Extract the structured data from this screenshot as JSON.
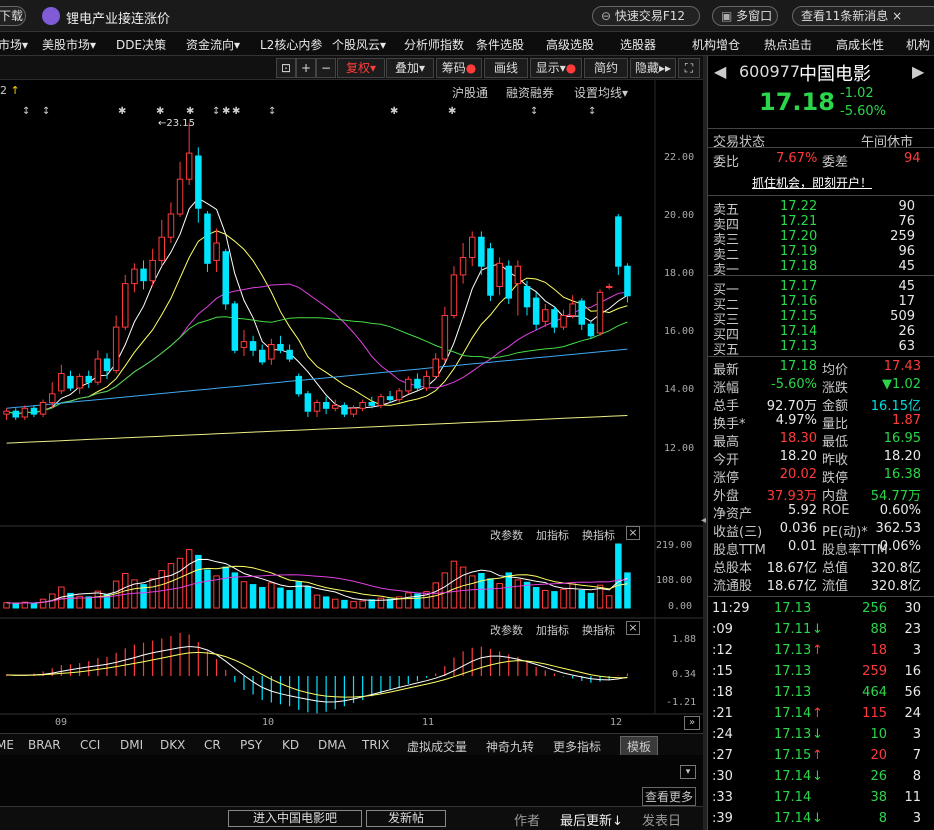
{
  "topbar": {
    "download": "下载",
    "news_ticker": "锂电产业接连涨价",
    "quick_trade": "快速交易F12",
    "multi_window": "多窗口",
    "view_news": "查看11条新消息",
    "close": "×"
  },
  "nav": [
    "市场",
    "美股市场",
    "DDE决策",
    "资金流向",
    "L2核心内参",
    "个股风云",
    "分析师指数",
    "条件选股",
    "高级选股",
    "选股器",
    "机构增仓",
    "热点追击",
    "高成长性",
    "机构"
  ],
  "chart_toolbar": {
    "fuquan": "复权",
    "overlay": "叠加",
    "chips": "筹码",
    "draw": "画线",
    "display": "显示",
    "simple": "简约",
    "hide": "隐藏"
  },
  "chart_header": {
    "period_num": "2",
    "hgt": "沪股通",
    "margin": "融资融券",
    "ma_settings": "设置均线",
    "peak_label": "23.15"
  },
  "chart_data": {
    "type": "candlestick",
    "price_axis": {
      "ticks": [
        "22.00",
        "20.00",
        "18.00",
        "16.00",
        "14.00",
        "12.00"
      ]
    },
    "volume_axis": {
      "ticks": [
        "219.00",
        "108.00",
        "0.00"
      ]
    },
    "macd_axis": {
      "ticks": [
        "1.88",
        "0.34",
        "-1.21"
      ]
    },
    "x_labels": [
      "09",
      "10",
      "11",
      "12"
    ],
    "peak": 23.15,
    "last_close": 17.18,
    "candles": [
      {
        "o": 13.1,
        "c": 13.2,
        "h": 13.3,
        "l": 12.9
      },
      {
        "o": 13.2,
        "c": 13.0,
        "h": 13.3,
        "l": 12.9
      },
      {
        "o": 13.0,
        "c": 13.3,
        "h": 13.4,
        "l": 12.9
      },
      {
        "o": 13.3,
        "c": 13.1,
        "h": 13.4,
        "l": 13.0
      },
      {
        "o": 13.1,
        "c": 13.5,
        "h": 13.6,
        "l": 13.0
      },
      {
        "o": 13.5,
        "c": 13.8,
        "h": 14.2,
        "l": 13.3
      },
      {
        "o": 13.9,
        "c": 14.5,
        "h": 14.8,
        "l": 13.8
      },
      {
        "o": 14.4,
        "c": 14.0,
        "h": 14.6,
        "l": 13.9
      },
      {
        "o": 14.0,
        "c": 14.4,
        "h": 14.5,
        "l": 13.8
      },
      {
        "o": 14.4,
        "c": 14.2,
        "h": 14.6,
        "l": 14.0
      },
      {
        "o": 14.2,
        "c": 15.0,
        "h": 15.3,
        "l": 14.1
      },
      {
        "o": 15.0,
        "c": 14.6,
        "h": 15.2,
        "l": 14.3
      },
      {
        "o": 14.6,
        "c": 16.1,
        "h": 16.5,
        "l": 14.5
      },
      {
        "o": 16.1,
        "c": 17.6,
        "h": 17.9,
        "l": 16.0
      },
      {
        "o": 17.6,
        "c": 18.1,
        "h": 18.3,
        "l": 17.3
      },
      {
        "o": 18.1,
        "c": 17.7,
        "h": 18.4,
        "l": 17.4
      },
      {
        "o": 17.7,
        "c": 18.4,
        "h": 18.8,
        "l": 17.5
      },
      {
        "o": 18.4,
        "c": 19.2,
        "h": 19.8,
        "l": 18.2
      },
      {
        "o": 19.2,
        "c": 20.0,
        "h": 20.4,
        "l": 19.0
      },
      {
        "o": 20.0,
        "c": 21.2,
        "h": 21.8,
        "l": 19.9
      },
      {
        "o": 21.2,
        "c": 22.1,
        "h": 23.15,
        "l": 21.0
      },
      {
        "o": 22.0,
        "c": 20.2,
        "h": 22.3,
        "l": 19.7
      },
      {
        "o": 20.0,
        "c": 18.3,
        "h": 20.1,
        "l": 18.0
      },
      {
        "o": 18.4,
        "c": 19.0,
        "h": 19.5,
        "l": 18.0
      },
      {
        "o": 18.7,
        "c": 16.9,
        "h": 18.8,
        "l": 16.7
      },
      {
        "o": 16.9,
        "c": 15.3,
        "h": 17.0,
        "l": 15.2
      },
      {
        "o": 15.4,
        "c": 15.6,
        "h": 16.0,
        "l": 15.1
      },
      {
        "o": 15.6,
        "c": 15.3,
        "h": 15.8,
        "l": 15.1
      },
      {
        "o": 15.3,
        "c": 14.9,
        "h": 15.5,
        "l": 14.8
      },
      {
        "o": 15.0,
        "c": 15.5,
        "h": 15.7,
        "l": 14.8
      },
      {
        "o": 15.5,
        "c": 15.3,
        "h": 15.8,
        "l": 15.2
      },
      {
        "o": 15.3,
        "c": 15.0,
        "h": 15.5,
        "l": 14.9
      },
      {
        "o": 14.4,
        "c": 13.8,
        "h": 14.5,
        "l": 13.7
      },
      {
        "o": 13.8,
        "c": 13.2,
        "h": 13.9,
        "l": 13.0
      },
      {
        "o": 13.2,
        "c": 13.5,
        "h": 13.6,
        "l": 13.0
      },
      {
        "o": 13.5,
        "c": 13.3,
        "h": 13.7,
        "l": 13.1
      },
      {
        "o": 13.3,
        "c": 13.4,
        "h": 13.6,
        "l": 13.2
      },
      {
        "o": 13.4,
        "c": 13.1,
        "h": 13.5,
        "l": 13.0
      },
      {
        "o": 13.1,
        "c": 13.3,
        "h": 13.4,
        "l": 13.0
      },
      {
        "o": 13.3,
        "c": 13.5,
        "h": 13.6,
        "l": 13.2
      },
      {
        "o": 13.5,
        "c": 13.4,
        "h": 13.7,
        "l": 13.3
      },
      {
        "o": 13.4,
        "c": 13.7,
        "h": 13.8,
        "l": 13.3
      },
      {
        "o": 13.7,
        "c": 13.6,
        "h": 13.9,
        "l": 13.5
      },
      {
        "o": 13.6,
        "c": 13.9,
        "h": 14.0,
        "l": 13.5
      },
      {
        "o": 13.9,
        "c": 14.3,
        "h": 14.4,
        "l": 13.8
      },
      {
        "o": 14.3,
        "c": 14.0,
        "h": 14.5,
        "l": 13.9
      },
      {
        "o": 14.0,
        "c": 14.4,
        "h": 14.6,
        "l": 13.9
      },
      {
        "o": 14.4,
        "c": 15.0,
        "h": 15.2,
        "l": 14.3
      },
      {
        "o": 15.0,
        "c": 16.5,
        "h": 16.8,
        "l": 14.9
      },
      {
        "o": 16.5,
        "c": 17.9,
        "h": 18.2,
        "l": 16.4
      },
      {
        "o": 17.9,
        "c": 18.5,
        "h": 19.0,
        "l": 17.6
      },
      {
        "o": 18.5,
        "c": 19.2,
        "h": 19.4,
        "l": 18.2
      },
      {
        "o": 19.2,
        "c": 18.2,
        "h": 19.4,
        "l": 17.9
      },
      {
        "o": 18.8,
        "c": 17.2,
        "h": 19.0,
        "l": 17.0
      },
      {
        "o": 17.5,
        "c": 18.3,
        "h": 18.5,
        "l": 17.2
      },
      {
        "o": 18.2,
        "c": 17.1,
        "h": 18.4,
        "l": 16.9
      },
      {
        "o": 17.6,
        "c": 18.2,
        "h": 18.4,
        "l": 16.5
      },
      {
        "o": 17.5,
        "c": 16.8,
        "h": 17.7,
        "l": 16.5
      },
      {
        "o": 17.1,
        "c": 16.2,
        "h": 17.3,
        "l": 16.0
      },
      {
        "o": 16.3,
        "c": 16.7,
        "h": 16.9,
        "l": 16.1
      },
      {
        "o": 16.7,
        "c": 16.1,
        "h": 16.8,
        "l": 15.9
      },
      {
        "o": 16.1,
        "c": 16.5,
        "h": 16.7,
        "l": 16.0
      },
      {
        "o": 16.5,
        "c": 16.9,
        "h": 17.2,
        "l": 16.4
      },
      {
        "o": 17.0,
        "c": 16.2,
        "h": 17.1,
        "l": 16.0
      },
      {
        "o": 16.2,
        "c": 15.8,
        "h": 16.3,
        "l": 15.7
      },
      {
        "o": 15.9,
        "c": 17.3,
        "h": 17.4,
        "l": 15.8
      },
      {
        "o": 17.5,
        "c": 17.5,
        "h": 17.6,
        "l": 17.4
      },
      {
        "o": 19.9,
        "c": 18.2,
        "h": 20.0,
        "l": 17.9
      },
      {
        "o": 18.2,
        "c": 17.18,
        "h": 18.3,
        "l": 16.95
      }
    ],
    "volume": [
      18,
      14,
      20,
      16,
      30,
      48,
      72,
      50,
      40,
      38,
      58,
      46,
      92,
      118,
      96,
      80,
      100,
      128,
      152,
      170,
      200,
      180,
      130,
      110,
      140,
      120,
      90,
      80,
      70,
      86,
      68,
      60,
      90,
      72,
      44,
      38,
      30,
      26,
      22,
      24,
      28,
      34,
      30,
      38,
      52,
      48,
      56,
      86,
      120,
      160,
      140,
      110,
      118,
      100,
      84,
      120,
      96,
      88,
      70,
      60,
      56,
      64,
      82,
      60,
      50,
      78,
      42,
      219,
      120
    ],
    "macd": [
      0.05,
      0.02,
      0.04,
      0.08,
      0.15,
      0.25,
      0.35,
      0.38,
      0.42,
      0.48,
      0.58,
      0.62,
      0.75,
      0.9,
      1.02,
      1.08,
      1.15,
      1.22,
      1.3,
      1.4,
      1.35,
      1.1,
      0.8,
      0.55,
      0.2,
      -0.2,
      -0.45,
      -0.6,
      -0.78,
      -0.86,
      -0.92,
      -0.98,
      -1.1,
      -1.18,
      -1.21,
      -1.16,
      -1.08,
      -0.98,
      -0.88,
      -0.78,
      -0.66,
      -0.56,
      -0.46,
      -0.36,
      -0.26,
      -0.16,
      -0.06,
      0.08,
      0.32,
      0.6,
      0.8,
      0.92,
      0.95,
      0.88,
      0.8,
      0.7,
      0.62,
      0.45,
      0.3,
      0.18,
      0.08,
      -0.02,
      -0.08,
      -0.16,
      -0.22,
      -0.18,
      -0.14,
      0.02,
      0.08
    ]
  },
  "indicator_panels": {
    "params": "改参数",
    "add_indicator": "加指标",
    "switch_indicator": "换指标"
  },
  "indicator_tabs": [
    "ME",
    "BRAR",
    "CCI",
    "DMI",
    "DKX",
    "CR",
    "PSY",
    "KD",
    "DMA",
    "TRIX",
    "虚拟成交量",
    "神奇九转",
    "更多指标",
    "模板"
  ],
  "bottom": {
    "view_more": "查看更多",
    "forum": "进入中国电影吧",
    "post": "发新帖",
    "author": "作者",
    "latest": "最后更新",
    "post_date": "发表日"
  },
  "stock": {
    "code": "600977",
    "name": "中国电影",
    "price": "17.18",
    "change": "-1.02",
    "change_pct": "-5.60%",
    "trade_status_label": "交易状态",
    "trade_status": "午间休市",
    "weibi_label": "委比",
    "weibi": "7.67%",
    "weicha_label": "委差",
    "weicha": "94",
    "promo": "抓住机会，即刻开户！"
  },
  "order_book": {
    "asks": [
      {
        "label": "卖五",
        "price": "17.22",
        "vol": "90"
      },
      {
        "label": "卖四",
        "price": "17.21",
        "vol": "76"
      },
      {
        "label": "卖三",
        "price": "17.20",
        "vol": "259"
      },
      {
        "label": "卖二",
        "price": "17.19",
        "vol": "96"
      },
      {
        "label": "卖一",
        "price": "17.18",
        "vol": "45"
      }
    ],
    "bids": [
      {
        "label": "买一",
        "price": "17.17",
        "vol": "45"
      },
      {
        "label": "买二",
        "price": "17.16",
        "vol": "17"
      },
      {
        "label": "买三",
        "price": "17.15",
        "vol": "509"
      },
      {
        "label": "买四",
        "price": "17.14",
        "vol": "26"
      },
      {
        "label": "买五",
        "price": "17.13",
        "vol": "63"
      }
    ]
  },
  "stats": [
    {
      "l1": "最新",
      "v1": "17.18",
      "c1": "dn",
      "l2": "均价",
      "v2": "17.43",
      "c2": "up"
    },
    {
      "l1": "涨幅",
      "v1": "-5.60%",
      "c1": "dn",
      "l2": "涨跌",
      "v2": "▼1.02",
      "c2": "dn"
    },
    {
      "l1": "总手",
      "v1": "92.70万",
      "c1": "wt",
      "l2": "金额",
      "v2": "16.15亿",
      "c2": "cy"
    },
    {
      "l1": "换手*",
      "v1": "4.97%",
      "c1": "wt",
      "l2": "量比",
      "v2": "1.87",
      "c2": "up"
    },
    {
      "l1": "最高",
      "v1": "18.30",
      "c1": "up",
      "l2": "最低",
      "v2": "16.95",
      "c2": "dn"
    },
    {
      "l1": "今开",
      "v1": "18.20",
      "c1": "wt",
      "l2": "昨收",
      "v2": "18.20",
      "c2": "wt"
    },
    {
      "l1": "涨停",
      "v1": "20.02",
      "c1": "up",
      "l2": "跌停",
      "v2": "16.38",
      "c2": "dn"
    },
    {
      "l1": "外盘",
      "v1": "37.93万",
      "c1": "up",
      "l2": "内盘",
      "v2": "54.77万",
      "c2": "dn"
    },
    {
      "l1": "净资产",
      "v1": "5.92",
      "c1": "wt",
      "l2": "ROE",
      "v2": "0.60%",
      "c2": "wt"
    },
    {
      "l1": "收益(三)",
      "v1": "0.036",
      "c1": "wt",
      "l2": "PE(动)*",
      "v2": "362.53",
      "c2": "wt"
    },
    {
      "l1": "股息TTM",
      "v1": "0.01",
      "c1": "wt",
      "l2": "股息率TTM",
      "v2": "0.06%",
      "c2": "wt"
    },
    {
      "l1": "总股本",
      "v1": "18.67亿",
      "c1": "wt",
      "l2": "总值",
      "v2": "320.8亿",
      "c2": "wt"
    },
    {
      "l1": "流通股",
      "v1": "18.67亿",
      "c1": "wt",
      "l2": "流值",
      "v2": "320.8亿",
      "c2": "wt"
    }
  ],
  "ticks": [
    {
      "time": "11:29",
      "price": "17.13",
      "arrow": "",
      "vol": "256",
      "n": "30",
      "c": "dn"
    },
    {
      "time": ":09",
      "price": "17.11",
      "arrow": "↓",
      "vol": "88",
      "n": "23",
      "c": "dn"
    },
    {
      "time": ":12",
      "price": "17.13",
      "arrow": "↑",
      "vol": "18",
      "n": "3",
      "c": "up"
    },
    {
      "time": ":15",
      "price": "17.13",
      "arrow": "",
      "vol": "259",
      "n": "16",
      "c": "up"
    },
    {
      "time": ":18",
      "price": "17.13",
      "arrow": "",
      "vol": "464",
      "n": "56",
      "c": "dn"
    },
    {
      "time": ":21",
      "price": "17.14",
      "arrow": "↑",
      "vol": "115",
      "n": "24",
      "c": "up"
    },
    {
      "time": ":24",
      "price": "17.13",
      "arrow": "↓",
      "vol": "10",
      "n": "3",
      "c": "dn"
    },
    {
      "time": ":27",
      "price": "17.15",
      "arrow": "↑",
      "vol": "20",
      "n": "7",
      "c": "up"
    },
    {
      "time": ":30",
      "price": "17.14",
      "arrow": "↓",
      "vol": "26",
      "n": "8",
      "c": "dn"
    },
    {
      "time": ":33",
      "price": "17.14",
      "arrow": "",
      "vol": "38",
      "n": "11",
      "c": "dn"
    },
    {
      "time": ":39",
      "price": "17.14",
      "arrow": "↓",
      "vol": "8",
      "n": "3",
      "c": "dn"
    }
  ],
  "colors": {
    "up": "#ff3b3b",
    "down": "#00e5ff",
    "ma5": "#ffffff",
    "ma10": "#ffff66",
    "ma20": "#e040e0",
    "ma30": "#44dd44",
    "ma60": "#3fa9f5",
    "ma120": "#eeee88"
  }
}
